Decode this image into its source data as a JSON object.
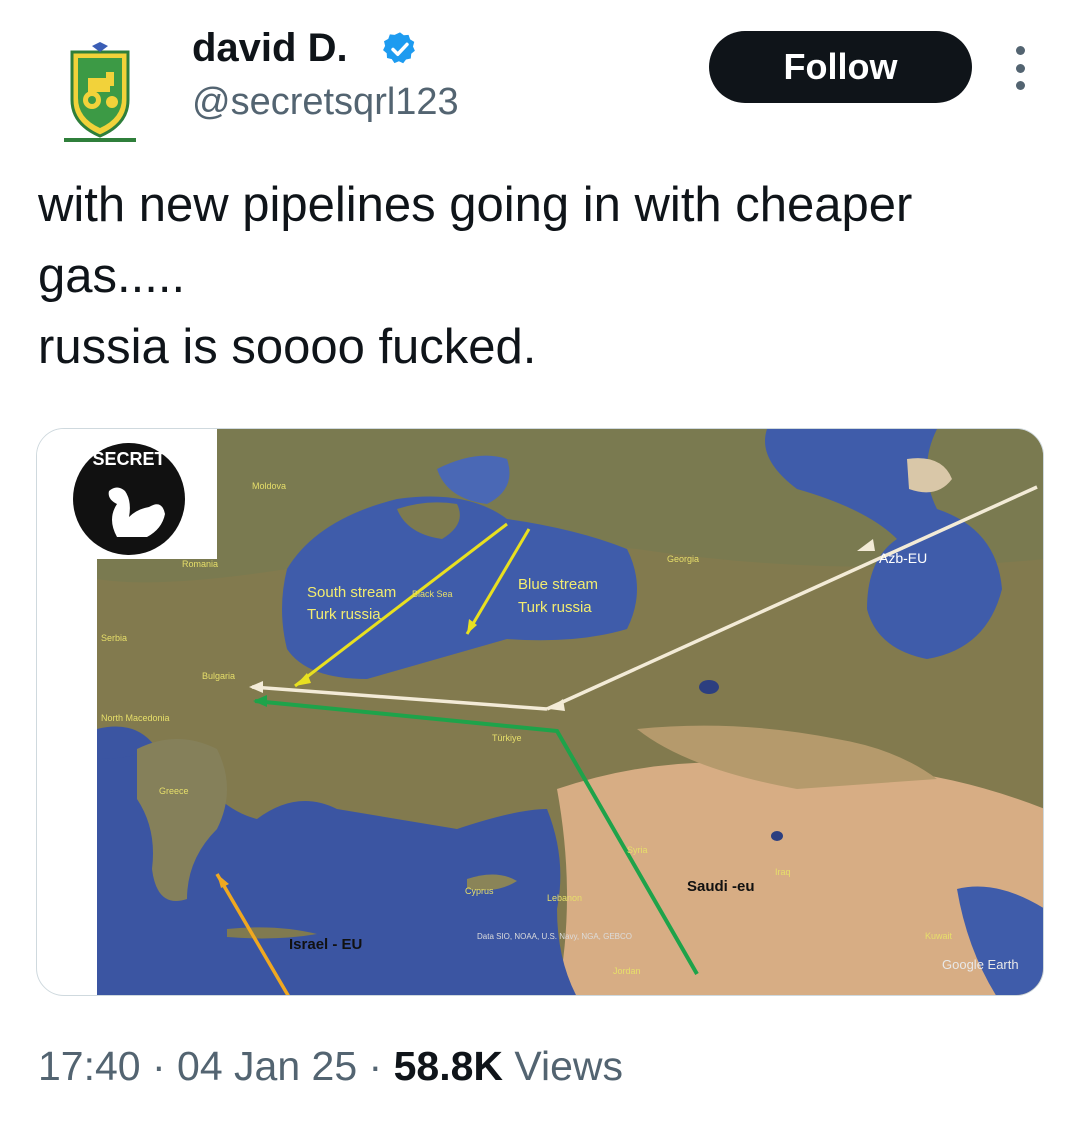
{
  "author": {
    "display_name": "david D.",
    "handle": "@secretsqrl123",
    "verified": true,
    "avatar_icon": "tractor-crest-icon"
  },
  "follow_button": {
    "label": "Follow"
  },
  "more_menu": {
    "icon": "more-vertical-icon"
  },
  "tweet": {
    "lines": [
      "with new pipelines going in with cheaper",
      "gas.....",
      "russia is soooo fucked."
    ]
  },
  "media": {
    "logo": {
      "text": "SECRET",
      "icon": "squirrel-icon"
    },
    "map_labels": {
      "south_stream_1": "South stream",
      "south_stream_2": "Turk russia",
      "blue_stream_1": "Blue stream",
      "blue_stream_2": "Turk russia",
      "azb_eu": "Azb-EU",
      "saudi_eu": "Saudi -eu",
      "israel_eu": "Israel - EU",
      "black_sea": "Black Sea",
      "moldova": "Moldova",
      "romania": "Romania",
      "serbia": "Serbia",
      "bulgaria": "Bulgaria",
      "north_macedonia": "North Macedonia",
      "greece": "Greece",
      "turkiye": "Türkiye",
      "georgia": "Georgia",
      "cyprus": "Cyprus",
      "lebanon": "Lebanon",
      "jordan": "Jordan",
      "iraq": "Iraq",
      "kuwait": "Kuwait",
      "syria": "Syria",
      "data_credit": "Data SIO, NOAA, U.S. Navy, NGA, GEBCO",
      "google_earth": "Google Earth"
    },
    "colors": {
      "sea": "#3d5aa8",
      "land": "#8a8452",
      "desert": "#d9b088",
      "yellow_route": "#e8e020",
      "white_route": "#f3ebd7",
      "green_route": "#1ea34a",
      "orange_route": "#f0a820"
    }
  },
  "meta": {
    "time": "17:40",
    "sep1": " · ",
    "date": "04 Jan 25",
    "sep2": " · ",
    "views_count": "58.8K",
    "views_label": " Views"
  }
}
